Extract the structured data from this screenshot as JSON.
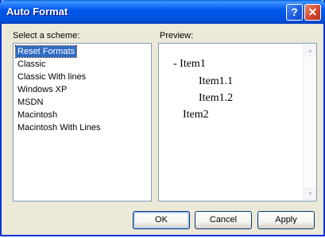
{
  "window": {
    "title": "Auto Format"
  },
  "titlebar": {
    "help_glyph": "?",
    "close_glyph": "✕"
  },
  "scheme": {
    "label": "Select a scheme:",
    "items": [
      "Reset Formats",
      "Classic",
      "Classic With lines",
      "Windows XP",
      "MSDN",
      "Macintosh",
      "Macintosh With Lines"
    ],
    "selected_index": 0
  },
  "preview": {
    "label": "Preview:",
    "tree": [
      {
        "text": "-  Item1"
      },
      {
        "text": "Item1.1"
      },
      {
        "text": "Item1.2"
      },
      {
        "text": "Item2"
      }
    ],
    "scroll_up_glyph": "▲",
    "scroll_down_glyph": "▼"
  },
  "buttons": {
    "ok": "OK",
    "cancel": "Cancel",
    "apply": "Apply"
  }
}
